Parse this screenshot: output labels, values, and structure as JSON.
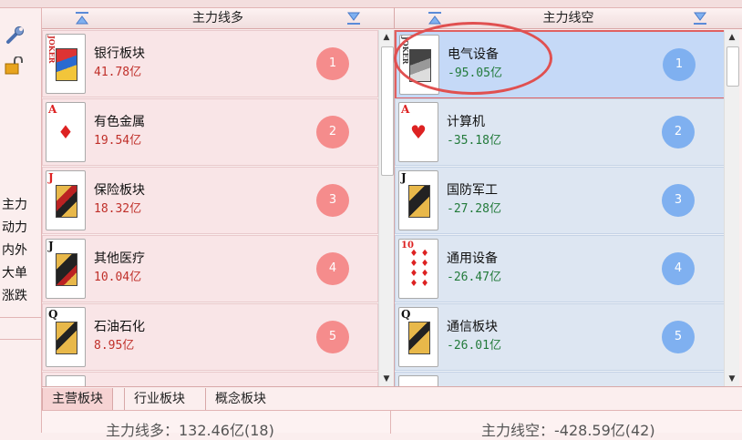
{
  "left_strip": {
    "labels": [
      "主力",
      "动力",
      "内外",
      "大单",
      "涨跌"
    ]
  },
  "panels": {
    "long": {
      "title": "主力线多",
      "rows": [
        {
          "card": "JOKER",
          "name": "银行板块",
          "value": "41.78亿",
          "rank": "1"
        },
        {
          "card": "A",
          "name": "有色金属",
          "value": "19.54亿",
          "rank": "2"
        },
        {
          "card": "J",
          "name": "保险板块",
          "value": "18.32亿",
          "rank": "3"
        },
        {
          "card": "J",
          "name": "其他医疗",
          "value": "10.04亿",
          "rank": "4"
        },
        {
          "card": "Q",
          "name": "石油石化",
          "value": "8.95亿",
          "rank": "5"
        }
      ]
    },
    "short": {
      "title": "主力线空",
      "rows": [
        {
          "card": "JOKER",
          "name": "电气设备",
          "value": "-95.05亿",
          "rank": "1"
        },
        {
          "card": "A",
          "name": "计算机",
          "value": "-35.18亿",
          "rank": "2"
        },
        {
          "card": "J",
          "name": "国防军工",
          "value": "-27.28亿",
          "rank": "3"
        },
        {
          "card": "10",
          "name": "通用设备",
          "value": "-26.47亿",
          "rank": "4"
        },
        {
          "card": "Q",
          "name": "通信板块",
          "value": "-26.01亿",
          "rank": "5"
        }
      ]
    }
  },
  "tabs": [
    "主营板块",
    "行业板块",
    "概念板块"
  ],
  "summary": {
    "long": "主力线多：132.46亿(18)",
    "short": "主力线空：-428.59亿(42)"
  },
  "colors": {
    "long_badge": "#f58c8c",
    "short_badge": "#7fb0f0",
    "long_value": "#c0302a",
    "short_value": "#227a3a",
    "annotation": "#e05050"
  }
}
